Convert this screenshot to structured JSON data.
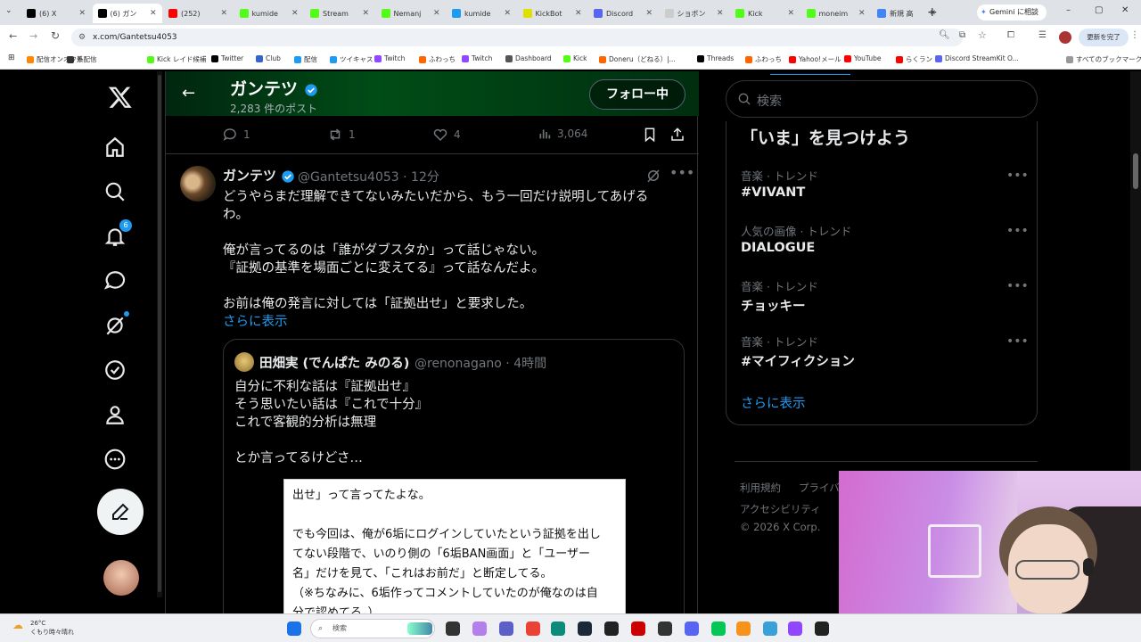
{
  "browser": {
    "tabs": [
      {
        "label": "(6) X",
        "color": "#000000"
      },
      {
        "label": "(6) ガン",
        "color": "#000000",
        "active": true
      },
      {
        "label": "(252)",
        "color": "#ff0000"
      },
      {
        "label": "kumide",
        "color": "#53fc18"
      },
      {
        "label": "Stream",
        "color": "#53fc18"
      },
      {
        "label": "Nemanj",
        "color": "#53fc18"
      },
      {
        "label": "kumide",
        "color": "#1d9bf0"
      },
      {
        "label": "KickBot",
        "color": "#e0e000"
      },
      {
        "label": "Discord",
        "color": "#5865f2"
      },
      {
        "label": "ショボン",
        "color": "#cccccc"
      },
      {
        "label": "Kick",
        "color": "#53fc18"
      },
      {
        "label": "moneim",
        "color": "#53fc18"
      },
      {
        "label": "新規 高",
        "color": "#4285f4"
      }
    ],
    "gemini_button": "Gemini に相談",
    "url": "x.com/Gantetsu4053",
    "update_button": "更新を完了",
    "bookmarks": [
      "配信オンオフ系",
      "外配信",
      "Kick レイド候補",
      "Twitter",
      "Club",
      "配信",
      "ツイキャス",
      "Twitch",
      "ふわっち",
      "Twitch",
      "Dashboard",
      "Kick",
      "Doneru（どねる）|...",
      "Threads",
      "ふわっち",
      "Yahoo!メール",
      "YouTube",
      "らくラン",
      "Discord StreamKit O...",
      "すべてのブックマーク"
    ]
  },
  "nav": {
    "notifications_badge": "6"
  },
  "profile_header": {
    "name": "ガンテツ",
    "post_count": "2,283 件のポスト",
    "follow_button": "フォロー中"
  },
  "previous_actions": {
    "replies": "1",
    "reposts": "1",
    "likes": "4",
    "views": "3,064"
  },
  "tweet": {
    "author_name": "ガンテツ",
    "handle_time": "@Gantetsu4053 · 12分",
    "lines": [
      "どうやらまだ理解できてないみたいだから、もう一回だけ説明してあげる",
      "わ。",
      "",
      "俺が言ってるのは「誰がダブスタか」って話じゃない。",
      "『証拠の基準を場面ごとに変えてる』って話なんだよ。",
      "",
      "お前は俺の発言に対しては「証拠出せ」と要求した。"
    ],
    "show_more": "さらに表示"
  },
  "quote": {
    "author_name": "田畑実 (でんぱた みのる)",
    "handle_time": "@renonagano · 4時間",
    "lines": [
      "自分に不利な話は『証拠出せ』",
      "そう思いたい話は『これで十分』",
      "これで客観的分析は無理",
      "",
      "とか言ってるけどさ…"
    ],
    "image_lines": [
      "出せ」って言ってたよな。",
      "",
      "でも今回は、俺が6垢にログインしていたという証拠を出し",
      "てない段階で、いのり側の「6垢BAN画面」と「ユーザー",
      "名」だけを見て、「これはお前だ」と断定してる。",
      "（※ちなみに、6垢作ってコメントしていたのが俺なのは自",
      "分で認めてる。）"
    ]
  },
  "sidebar": {
    "search_placeholder": "検索",
    "trends_title": "「いま」を見つけよう",
    "trends": [
      {
        "category": "音楽 · トレンド",
        "name": "#VIVANT"
      },
      {
        "category": "人気の画像 · トレンド",
        "name": "DIALOGUE"
      },
      {
        "category": "音楽 · トレンド",
        "name": "チョッキー"
      },
      {
        "category": "音楽 · トレンド",
        "name": "#マイフィクション"
      }
    ],
    "show_more": "さらに表示",
    "footer": {
      "terms": "利用規約",
      "privacy": "プライバ",
      "accessibility": "アクセシビリティ",
      "copyright": "© 2026 X Corp."
    }
  },
  "taskbar": {
    "weather_temp": "26°C",
    "weather_desc": "くもり時々晴れ",
    "search_label": "検索"
  },
  "colors": {
    "accent": "#1d9bf0",
    "background": "#000000",
    "text": "#e7e9ea",
    "muted": "#71767b"
  }
}
